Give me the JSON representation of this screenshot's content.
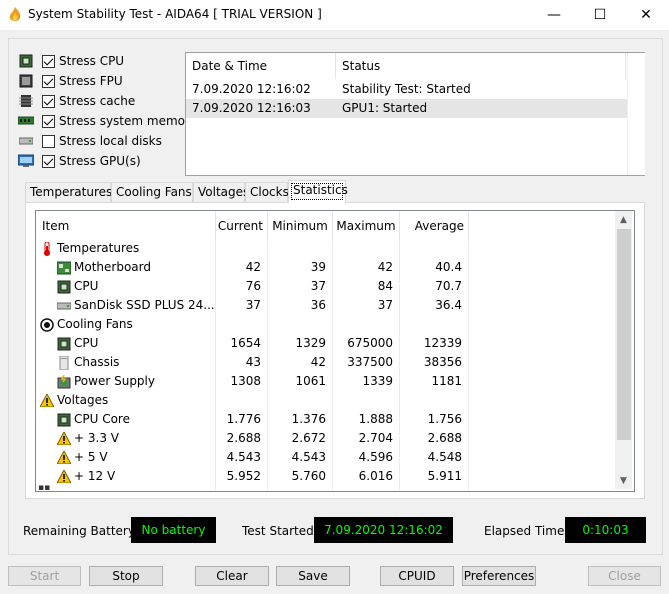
{
  "window": {
    "title": "System Stability Test - AIDA64  [ TRIAL VERSION ]",
    "minimize": "—",
    "maximize": "☐",
    "close": "✕"
  },
  "stress_options": [
    {
      "label": "Stress CPU",
      "checked": true,
      "icon": "cpu-icon"
    },
    {
      "label": "Stress FPU",
      "checked": true,
      "icon": "fpu-icon"
    },
    {
      "label": "Stress cache",
      "checked": true,
      "icon": "cache-icon"
    },
    {
      "label": "Stress system memory",
      "checked": true,
      "icon": "memory-icon"
    },
    {
      "label": "Stress local disks",
      "checked": false,
      "icon": "disk-icon"
    },
    {
      "label": "Stress GPU(s)",
      "checked": true,
      "icon": "gpu-icon"
    }
  ],
  "log": {
    "headers": {
      "datetime": "Date & Time",
      "status": "Status"
    },
    "rows": [
      {
        "datetime": "7.09.2020 12:16:02",
        "status": "Stability Test: Started"
      },
      {
        "datetime": "7.09.2020 12:16:03",
        "status": "GPU1: Started"
      }
    ]
  },
  "tabs": [
    "Temperatures",
    "Cooling Fans",
    "Voltages",
    "Clocks",
    "Statistics"
  ],
  "active_tab": "Statistics",
  "stats": {
    "headers": {
      "item": "Item",
      "current": "Current",
      "minimum": "Minimum",
      "maximum": "Maximum",
      "average": "Average"
    },
    "rows": [
      {
        "type": "group",
        "name": "Temperatures",
        "icon": "thermometer-icon"
      },
      {
        "type": "item",
        "name": "Motherboard",
        "icon": "motherboard-icon",
        "current": "42",
        "minimum": "39",
        "maximum": "42",
        "average": "40.4"
      },
      {
        "type": "item",
        "name": "CPU",
        "icon": "cpu-icon",
        "current": "76",
        "minimum": "37",
        "maximum": "84",
        "average": "70.7"
      },
      {
        "type": "item",
        "name": "SanDisk SSD PLUS 24...",
        "icon": "disk-icon",
        "current": "37",
        "minimum": "36",
        "maximum": "37",
        "average": "36.4"
      },
      {
        "type": "group",
        "name": "Cooling Fans",
        "icon": "fan-icon"
      },
      {
        "type": "item",
        "name": "CPU",
        "icon": "cpu-icon",
        "current": "1654",
        "minimum": "1329",
        "maximum": "675000",
        "average": "12339"
      },
      {
        "type": "item",
        "name": "Chassis",
        "icon": "chassis-icon",
        "current": "43",
        "minimum": "42",
        "maximum": "337500",
        "average": "38356"
      },
      {
        "type": "item",
        "name": "Power Supply",
        "icon": "power-supply-icon",
        "current": "1308",
        "minimum": "1061",
        "maximum": "1339",
        "average": "1181"
      },
      {
        "type": "group",
        "name": "Voltages",
        "icon": "warning-icon"
      },
      {
        "type": "item",
        "name": "CPU Core",
        "icon": "cpu-icon",
        "current": "1.776",
        "minimum": "1.376",
        "maximum": "1.888",
        "average": "1.756"
      },
      {
        "type": "item",
        "name": "+ 3.3 V",
        "icon": "warning-icon",
        "current": "2.688",
        "minimum": "2.672",
        "maximum": "2.704",
        "average": "2.688"
      },
      {
        "type": "item",
        "name": "+ 5 V",
        "icon": "warning-icon",
        "current": "4.543",
        "minimum": "4.543",
        "maximum": "4.596",
        "average": "4.548"
      },
      {
        "type": "item",
        "name": "+ 12 V",
        "icon": "warning-icon",
        "current": "5.952",
        "minimum": "5.760",
        "maximum": "6.016",
        "average": "5.911"
      }
    ]
  },
  "status": {
    "battery_label": "Remaining Battery:",
    "battery_value": "No battery",
    "started_label": "Test Started:",
    "started_value": "7.09.2020 12:16:02",
    "elapsed_label": "Elapsed Time:",
    "elapsed_value": "0:10:03"
  },
  "buttons": {
    "start": "Start",
    "stop": "Stop",
    "clear": "Clear",
    "save": "Save",
    "cpuid": "CPUID",
    "preferences": "Preferences",
    "close": "Close"
  },
  "colors": {
    "led_text": "#00ff00",
    "led_bg": "#000000"
  }
}
